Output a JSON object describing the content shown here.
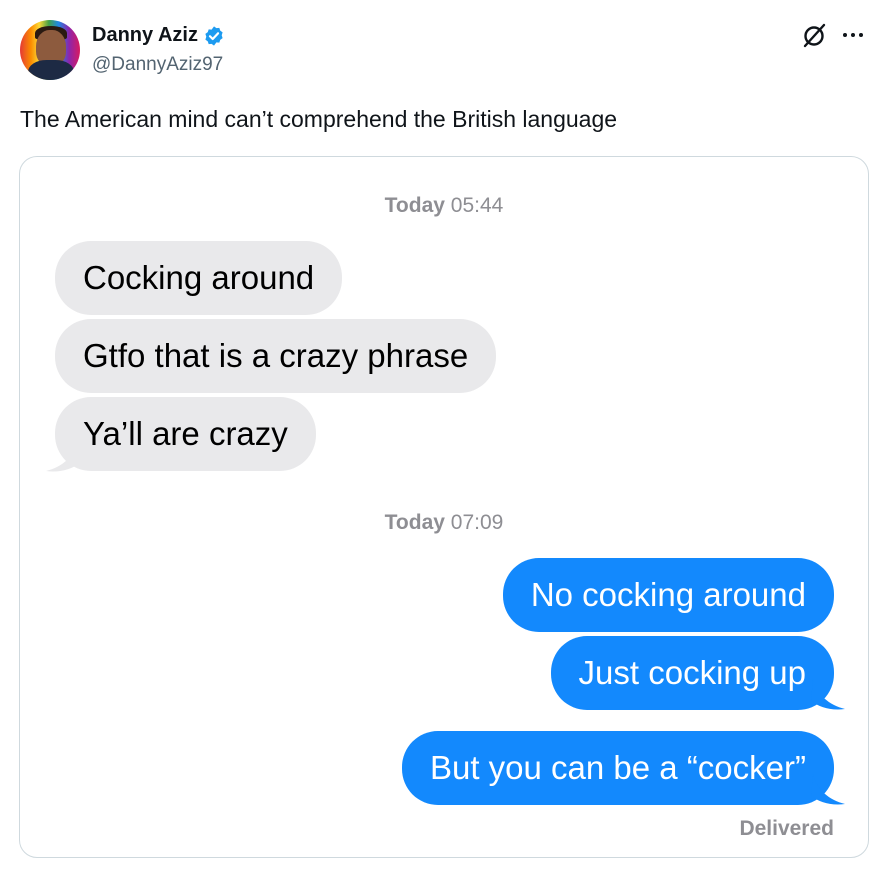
{
  "author": {
    "name": "Danny Aziz",
    "handle": "@DannyAziz97",
    "verified_color": "#1d9bf0"
  },
  "icons": {
    "grok": "grok-icon",
    "more": "more-icon",
    "verified": "verified-badge-icon"
  },
  "post": {
    "text": "The American mind can’t comprehend the British language"
  },
  "conversation": {
    "timestamp_1": {
      "day": "Today",
      "time": "05:44"
    },
    "received": [
      {
        "text": "Cocking around"
      },
      {
        "text": "Gtfo that is a crazy phrase"
      },
      {
        "text": "Ya’ll are crazy"
      }
    ],
    "timestamp_2": {
      "day": "Today",
      "time": "07:09"
    },
    "sent": [
      {
        "text": "No cocking around"
      },
      {
        "text": "Just cocking up"
      },
      {
        "text": "But you can be a “cocker”"
      }
    ],
    "status": "Delivered",
    "colors": {
      "received_bubble": "#e9e9eb",
      "sent_bubble": "#1389fd",
      "meta_text": "#8e8e93"
    }
  }
}
